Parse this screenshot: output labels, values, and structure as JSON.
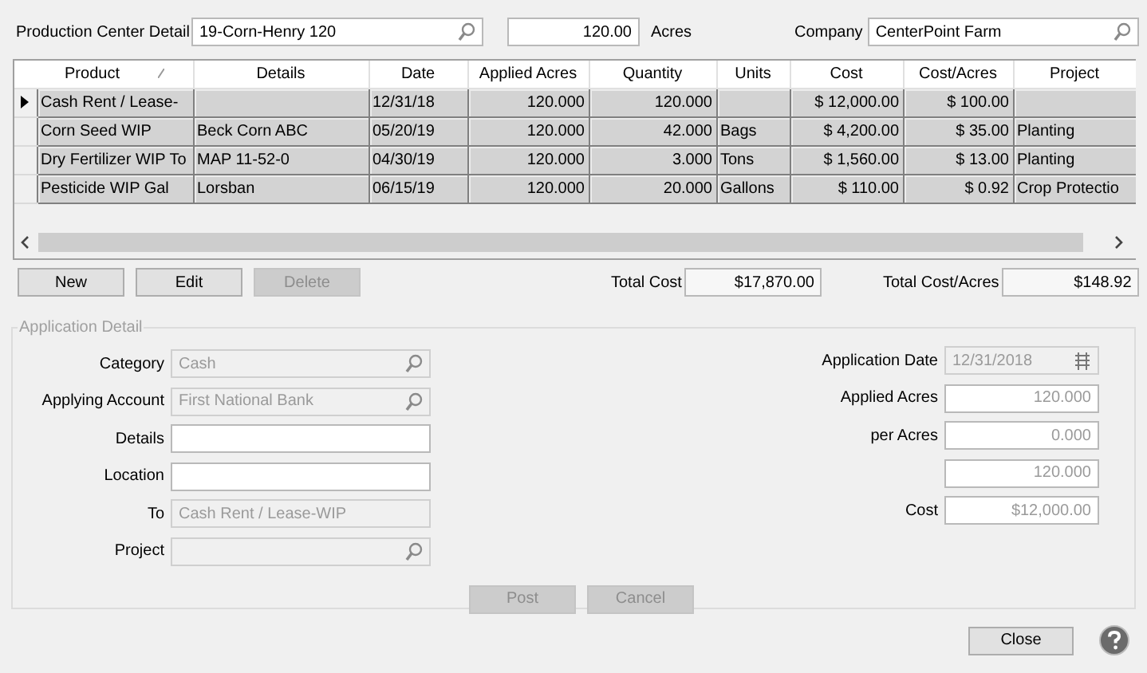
{
  "header": {
    "production_center": {
      "label": "Production Center Detail",
      "value": "19-Corn-Henry 120"
    },
    "acres": {
      "value": "120.00",
      "unit": "Acres"
    },
    "company": {
      "label": "Company",
      "value": "CenterPoint Farm"
    }
  },
  "grid": {
    "columns": [
      {
        "label": "Product",
        "sorted": true
      },
      {
        "label": "Details",
        "sorted": false
      },
      {
        "label": "Date",
        "sorted": false
      },
      {
        "label": "Applied Acres",
        "sorted": false
      },
      {
        "label": "Quantity",
        "sorted": false
      },
      {
        "label": "Units",
        "sorted": false
      },
      {
        "label": "Cost",
        "sorted": false
      },
      {
        "label": "Cost/Acres",
        "sorted": false
      },
      {
        "label": "Project",
        "sorted": false
      }
    ],
    "rows": [
      {
        "selected": true,
        "product": "Cash Rent / Lease-",
        "date": "12/31/18",
        "applied_acres": "120.000",
        "quantity": "120.000",
        "cost": "$ 12,000.00",
        "cost_per_acre": "$ 100.00"
      },
      {
        "selected": false,
        "product": "Corn Seed WIP",
        "details": "Beck Corn ABC",
        "date": "05/20/19",
        "applied_acres": "120.000",
        "quantity": "42.000",
        "units": "Bags",
        "cost": "$ 4,200.00",
        "cost_per_acre": "$ 35.00",
        "project": "Planting"
      },
      {
        "selected": false,
        "product": "Dry Fertilizer WIP To",
        "details": "MAP 11-52-0",
        "date": "04/30/19",
        "applied_acres": "120.000",
        "quantity": "3.000",
        "units": "Tons",
        "cost": "$ 1,560.00",
        "cost_per_acre": "$ 13.00",
        "project": "Planting"
      },
      {
        "selected": false,
        "product": "Pesticide WIP Gal",
        "details": "Lorsban",
        "date": "06/15/19",
        "applied_acres": "120.000",
        "quantity": "20.000",
        "units": "Gallons",
        "cost": "$ 110.00",
        "cost_per_acre": "$ 0.92",
        "project": "Crop Protectio"
      }
    ]
  },
  "actions": [
    {
      "label": "New",
      "disabled": false
    },
    {
      "label": "Edit",
      "disabled": false
    },
    {
      "label": "Delete",
      "disabled": true
    }
  ],
  "totals": [
    {
      "label": "Total Cost",
      "value": "$17,870.00"
    },
    {
      "label": "Total Cost/Acres",
      "value": "$148.92"
    }
  ],
  "application_detail": {
    "title": "Application Detail",
    "disabled": true,
    "left_fields": [
      {
        "label": "Category",
        "value": "Cash",
        "kind": "lookup",
        "disabled": true
      },
      {
        "label": "Applying Account",
        "value": "First National Bank",
        "kind": "lookup",
        "disabled": true
      },
      {
        "label": "Details",
        "kind": "text",
        "disabled": false
      },
      {
        "label": "Location",
        "kind": "text",
        "disabled": false
      },
      {
        "label": "To",
        "value": "Cash Rent / Lease-WIP",
        "kind": "text",
        "disabled": true
      },
      {
        "label": "Project",
        "kind": "lookup",
        "disabled": true
      }
    ],
    "right_fields": [
      {
        "label": "Application Date",
        "value": "12/31/2018",
        "kind": "date",
        "disabled": true
      },
      {
        "label": "Applied Acres",
        "value": "120.000",
        "kind": "number",
        "disabled": false
      },
      {
        "label": "per Acres",
        "value": "0.000",
        "kind": "number",
        "disabled": false
      },
      {
        "value": "120.000",
        "kind": "number",
        "disabled": false
      },
      {
        "label": "Cost",
        "value": "$12,000.00",
        "kind": "number",
        "disabled": false
      }
    ],
    "buttons": [
      {
        "label": "Post",
        "disabled": true
      },
      {
        "label": "Cancel",
        "disabled": true
      }
    ]
  },
  "footer": {
    "close": "Close"
  }
}
